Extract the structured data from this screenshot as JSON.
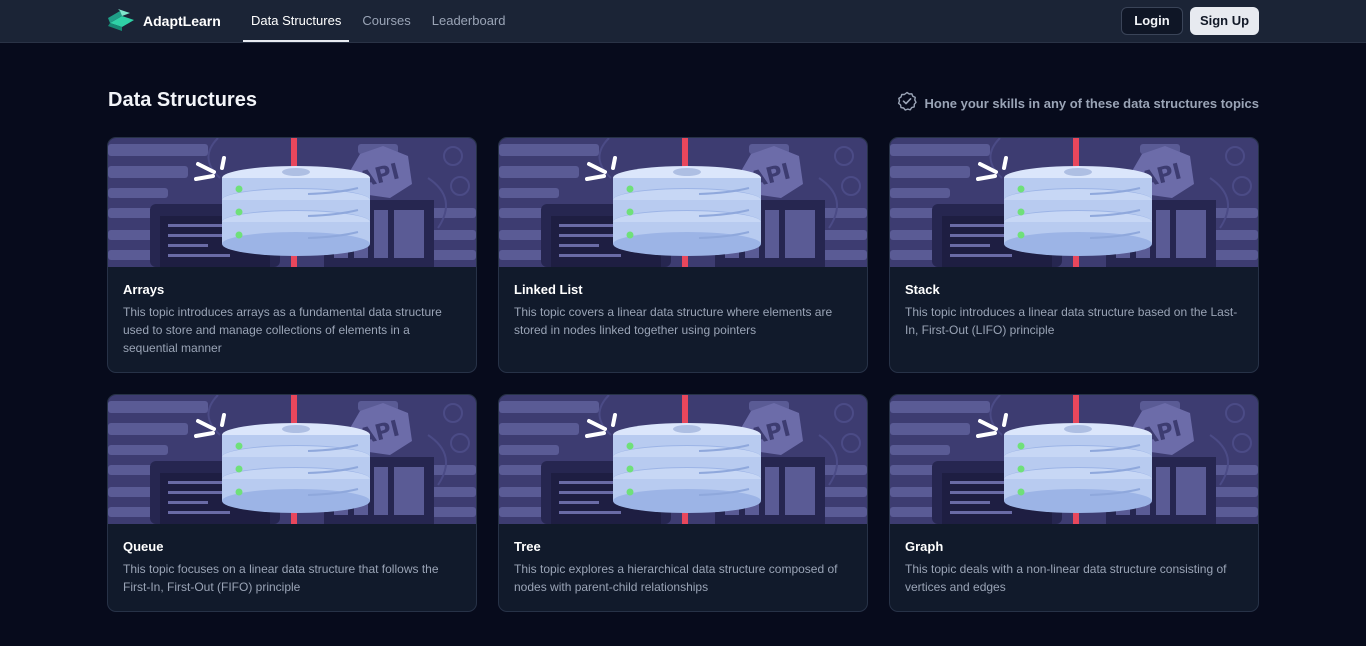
{
  "brand": {
    "name": "AdaptLearn"
  },
  "nav": {
    "links": [
      {
        "label": "Data Structures",
        "active": true
      },
      {
        "label": "Courses",
        "active": false
      },
      {
        "label": "Leaderboard",
        "active": false
      }
    ],
    "login_label": "Login",
    "signup_label": "Sign Up"
  },
  "page": {
    "title": "Data Structures",
    "hint": "Hone your skills in any of these data structures topics"
  },
  "illustration": {
    "badge_text": "API"
  },
  "cards": [
    {
      "title": "Arrays",
      "description": "This topic introduces arrays as a fundamental data structure used to store and manage collections of elements in a sequential manner"
    },
    {
      "title": "Linked List",
      "description": "This topic covers a linear data structure where elements are stored in nodes linked together using pointers"
    },
    {
      "title": "Stack",
      "description": "This topic introduces a linear data structure based on the Last-In, First-Out (LIFO) principle"
    },
    {
      "title": "Queue",
      "description": "This topic focuses on a linear data structure that follows the First-In, First-Out (FIFO) principle"
    },
    {
      "title": "Tree",
      "description": "This topic explores a hierarchical data structure composed of nodes with parent-child relationships"
    },
    {
      "title": "Graph",
      "description": "This topic deals with a non-linear data structure consisting of vertices and edges"
    }
  ],
  "colors": {
    "background": "#070b1c",
    "navbar": "#1b2436",
    "card": "#111a2b",
    "brand_accent": "#2fd1a6",
    "illustration_bg": "#3d3c71",
    "pole": "#e8475c"
  },
  "progress": {
    "fraction": 0.2
  }
}
